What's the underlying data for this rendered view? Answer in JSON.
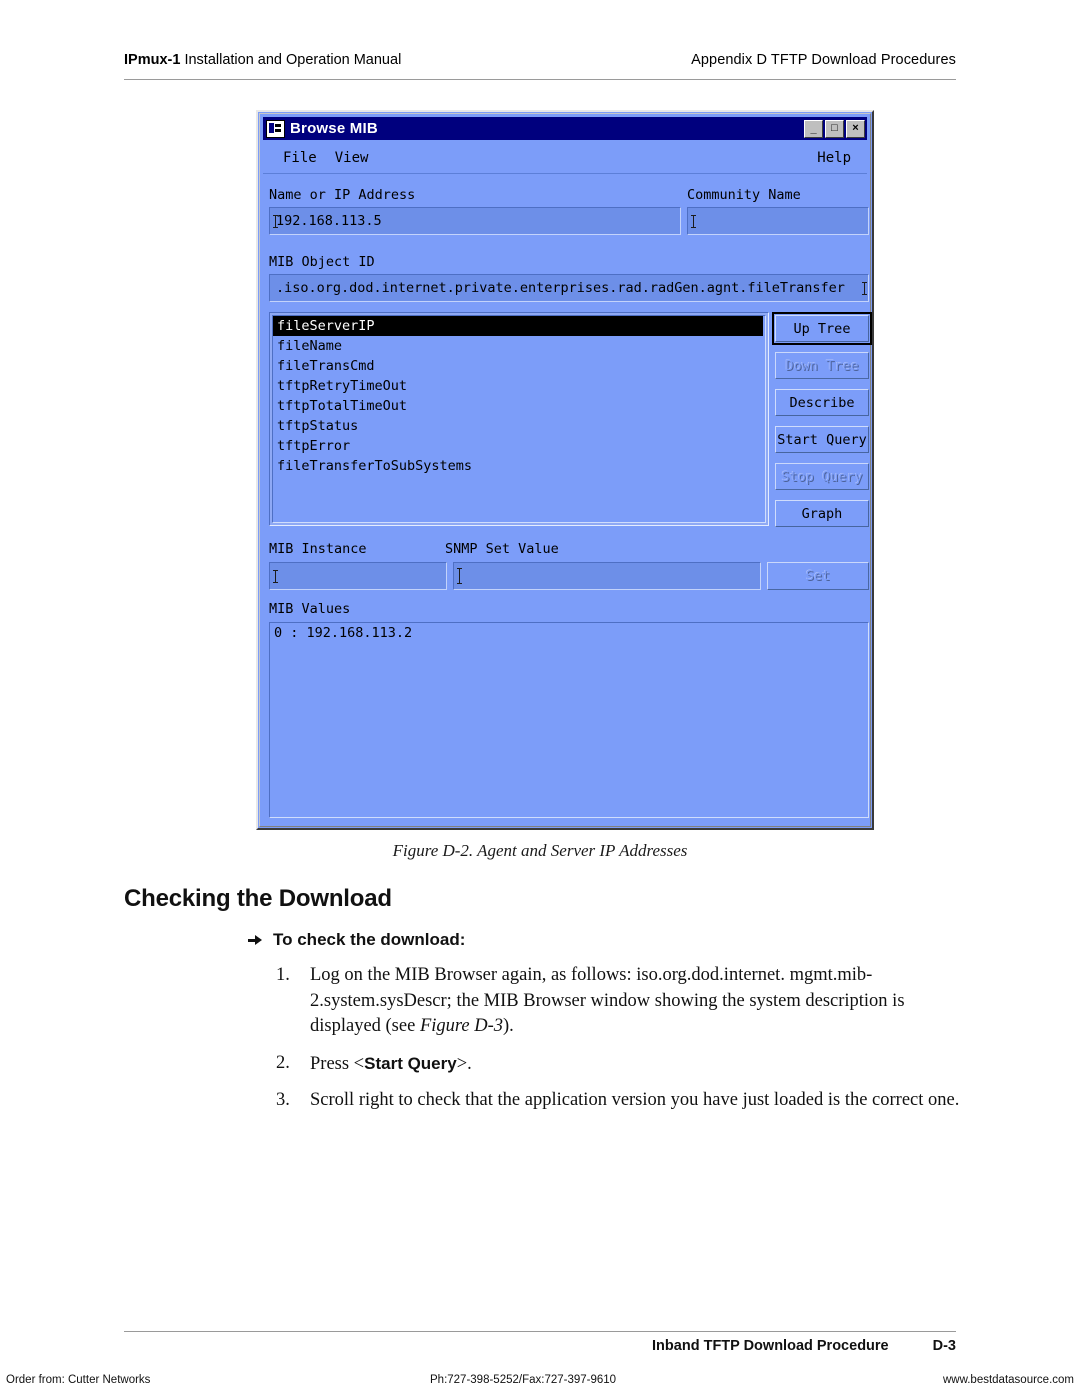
{
  "page_header": {
    "left_bold": "IPmux-1",
    "left_rest": " Installation and Operation Manual",
    "right": "Appendix D  TFTP Download Procedures"
  },
  "window": {
    "title": "Browse MIB",
    "title_icon": "mib-browser-icon",
    "controls": {
      "minimize": "_",
      "maximize": "□",
      "close": "×"
    },
    "menu": {
      "file": "File",
      "view": "View",
      "help": "Help"
    },
    "fields": {
      "name_or_ip_label": "Name or IP Address",
      "name_or_ip_value": "192.168.113.5",
      "community_label": "Community Name",
      "community_value": "",
      "mib_object_id_label": "MIB Object ID",
      "mib_object_id_value": ".iso.org.dod.internet.private.enterprises.rad.radGen.agnt.fileTransfer",
      "mib_instance_label": "MIB Instance",
      "mib_instance_value": "",
      "snmp_set_value_label": "SNMP Set Value",
      "snmp_set_value_value": "",
      "mib_values_label": "MIB Values",
      "mib_values_rows": [
        "0 : 192.168.113.2"
      ]
    },
    "tree_items": [
      {
        "label": "fileServerIP",
        "selected": true
      },
      {
        "label": "fileName",
        "selected": false
      },
      {
        "label": "fileTransCmd",
        "selected": false
      },
      {
        "label": "tftpRetryTimeOut",
        "selected": false
      },
      {
        "label": "tftpTotalTimeOut",
        "selected": false
      },
      {
        "label": "tftpStatus",
        "selected": false
      },
      {
        "label": "tftpError",
        "selected": false
      },
      {
        "label": "fileTransferToSubSystems",
        "selected": false
      }
    ],
    "buttons": [
      {
        "label": "Up Tree",
        "state": "focused"
      },
      {
        "label": "Down Tree",
        "state": "disabled"
      },
      {
        "label": "Describe",
        "state": "normal"
      },
      {
        "label": "Start Query",
        "state": "normal"
      },
      {
        "label": "Stop Query",
        "state": "disabled"
      },
      {
        "label": "Graph",
        "state": "normal"
      }
    ],
    "set_button": {
      "label": "Set",
      "state": "disabled"
    }
  },
  "figure_caption": "Figure D-2.  Agent and Server IP Addresses",
  "section_heading": "Checking the Download",
  "procedure_heading": "To check the download:",
  "steps": [
    {
      "num": "1.",
      "parts": [
        {
          "t": "Log on the MIB Browser again, as follows: iso.org.dod.internet. mgmt.mib-2.system.sysDescr; the MIB Browser window showing the system description is displayed (see ",
          "style": "normal"
        },
        {
          "t": "Figure D-3",
          "style": "italic"
        },
        {
          "t": ").",
          "style": "normal"
        }
      ]
    },
    {
      "num": "2.",
      "parts": [
        {
          "t": "Press <",
          "style": "normal"
        },
        {
          "t": "Start Query",
          "style": "bold"
        },
        {
          "t": ">.",
          "style": "normal"
        }
      ]
    },
    {
      "num": "3.",
      "parts": [
        {
          "t": "Scroll right to check that the application version you have just loaded is the correct one.",
          "style": "normal"
        }
      ]
    }
  ],
  "footer": {
    "title": "Inband TFTP Download Procedure",
    "page": "D-3"
  },
  "bottom_bar": {
    "order_from": "Order from: Cutter Networks",
    "phone": "Ph:727-398-5252/Fax:727-397-9610",
    "website": "www.bestdatasource.com"
  },
  "colors": {
    "titlebar": "#00007e",
    "window_bg": "#7c9df9",
    "field_bg": "#6d8fe8",
    "selection": "#000000"
  }
}
